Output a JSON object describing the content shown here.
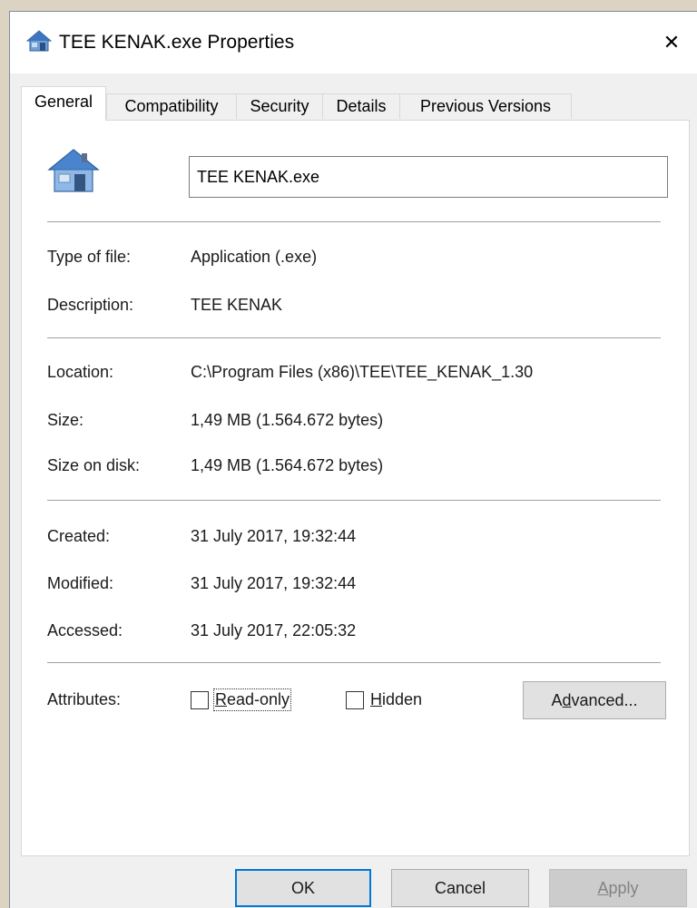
{
  "window": {
    "title": "TEE KENAK.exe Properties",
    "close_glyph": "✕"
  },
  "tabs": [
    {
      "label": "General",
      "active": true
    },
    {
      "label": "Compatibility",
      "active": false
    },
    {
      "label": "Security",
      "active": false
    },
    {
      "label": "Details",
      "active": false
    },
    {
      "label": "Previous Versions",
      "active": false
    }
  ],
  "general": {
    "file_name": "TEE KENAK.exe",
    "type_of_file": {
      "label": "Type of file:",
      "value": "Application (.exe)"
    },
    "description": {
      "label": "Description:",
      "value": "TEE KENAK"
    },
    "location": {
      "label": "Location:",
      "value": "C:\\Program Files (x86)\\TEE\\TEE_KENAK_1.30"
    },
    "size": {
      "label": "Size:",
      "value": "1,49 MB (1.564.672 bytes)"
    },
    "size_on_disk": {
      "label": "Size on disk:",
      "value": "1,49 MB (1.564.672 bytes)"
    },
    "created": {
      "label": "Created:",
      "value": "31 July 2017, 19:32:44"
    },
    "modified": {
      "label": "Modified:",
      "value": "31 July 2017, 19:32:44"
    },
    "accessed": {
      "label": "Accessed:",
      "value": "31 July 2017, 22:05:32"
    },
    "attributes": {
      "label": "Attributes:",
      "read_only": {
        "accel": "R",
        "rest": "ead-only",
        "checked": false
      },
      "hidden": {
        "accel": "H",
        "rest": "idden",
        "checked": false
      },
      "advanced": {
        "pre": "A",
        "accel": "d",
        "rest": "vanced..."
      }
    }
  },
  "buttons": {
    "ok": "OK",
    "cancel": "Cancel",
    "apply": {
      "accel": "A",
      "rest": "pply"
    }
  },
  "icons": {
    "title_icon": "house-icon",
    "file_icon": "house-icon"
  },
  "colors": {
    "accent": "#0078d7",
    "background": "#dcd3c2"
  }
}
